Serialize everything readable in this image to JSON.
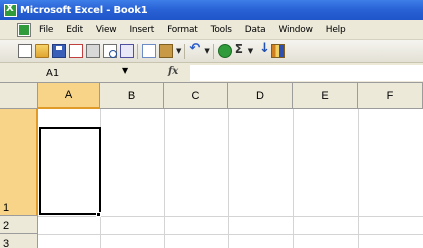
{
  "window": {
    "title": "Microsoft Excel - Book1"
  },
  "menu": {
    "items": [
      "File",
      "Edit",
      "View",
      "Insert",
      "Format",
      "Tools",
      "Data",
      "Window",
      "Help"
    ]
  },
  "toolbar": {
    "buttons": [
      "new-icon",
      "open-icon",
      "save-icon",
      "permission-icon",
      "print-icon",
      "print-preview-icon",
      "research-icon",
      "copy-icon",
      "paste-icon",
      "undo-icon",
      "hyperlink-icon",
      "autosum-icon",
      "sort-ascending-icon",
      "chart-wizard-icon"
    ]
  },
  "formula_bar": {
    "name_box": "A1",
    "fx_label": "fx",
    "content": ""
  },
  "sheet": {
    "columns": [
      "A",
      "B",
      "C",
      "D",
      "E",
      "F"
    ],
    "rows": [
      "1",
      "2",
      "3"
    ],
    "active_cell": "A1",
    "active_cell_value": ""
  },
  "colors": {
    "title_bar": "#2a63d6",
    "chrome": "#ece9d8",
    "active_header": "#f8d488",
    "active_header_accent": "#e09a28"
  }
}
